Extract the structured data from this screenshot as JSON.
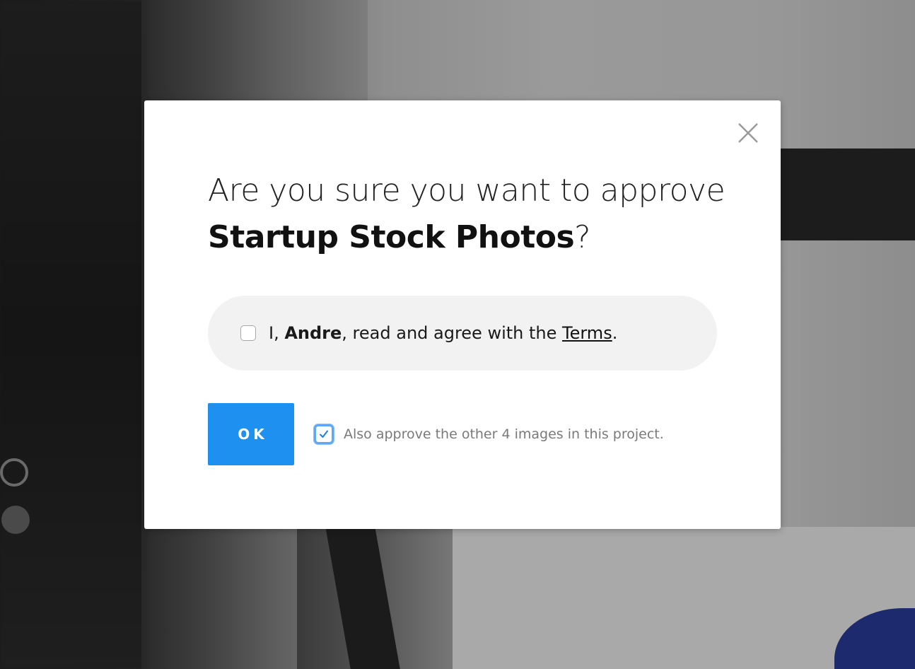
{
  "dialog": {
    "heading_prefix": "Are you sure you want to approve",
    "project_name": "Startup Stock Photos",
    "heading_suffix": "?",
    "close_icon": "close-icon"
  },
  "terms": {
    "prefix": "I, ",
    "user_name": "Andre",
    "middle": ", read and agree with the ",
    "link_label": "Terms",
    "suffix": ".",
    "checked": false
  },
  "actions": {
    "ok_label": "OK",
    "also_approve_label": "Also approve the other 4 images in this project.",
    "also_approve_checked": true
  },
  "colors": {
    "accent": "#1e90f0",
    "checkbox_focus": "#5ea8f5"
  }
}
